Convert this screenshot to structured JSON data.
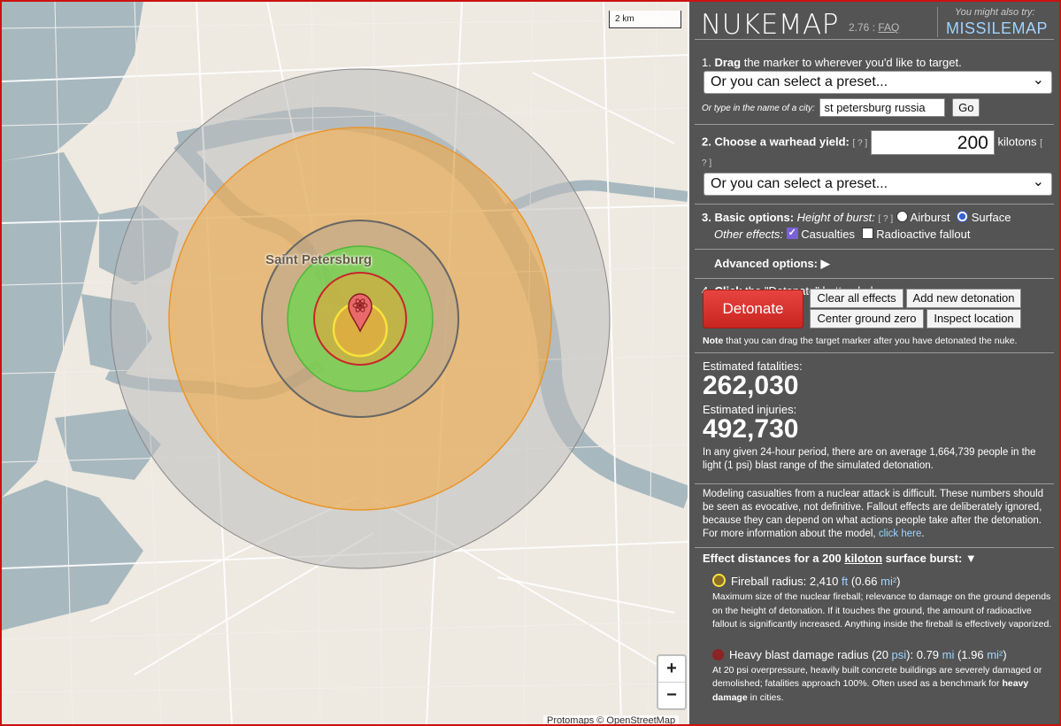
{
  "map": {
    "scale_label": "2 km",
    "city_label": "Saint Petersburg",
    "zoom_in": "+",
    "zoom_out": "−",
    "attribution": "Protomaps © OpenStreetMap"
  },
  "header": {
    "logo": "NUKEMAP",
    "version": "2.76 :",
    "faq": "FAQ",
    "also_try": "You might also try:",
    "missilemap": "MISSILEMAP"
  },
  "step1": {
    "prefix": "1. ",
    "bold": "Drag",
    "text": " the marker to wherever you'd like to target.",
    "preset_placeholder": "Or you can select a preset...",
    "city_prompt": "Or type in the name of a city:",
    "city_value": "st petersburg russia",
    "go_label": "Go"
  },
  "step2": {
    "label": "2. Choose a warhead yield:",
    "help": "[ ? ]",
    "yield_value": "200",
    "unit": "kilotons",
    "unit_help": "[ ? ]",
    "preset_placeholder": "Or you can select a preset..."
  },
  "step3": {
    "label": "3. Basic options:",
    "height_label": "Height of burst:",
    "height_help": "[ ? ]",
    "airburst": "Airburst",
    "surface": "Surface",
    "other_label": "Other effects:",
    "casualties": "Casualties",
    "fallout": "Radioactive fallout",
    "advanced": "Advanced options: ▶"
  },
  "step4": {
    "prefix": "4. ",
    "bold": "Click",
    "text": " the \"Detonate\" button below.",
    "detonate": "Detonate",
    "clear": "Clear all effects",
    "add": "Add new detonation",
    "center": "Center ground zero",
    "inspect": "Inspect location",
    "note_bold": "Note",
    "note_text": " that you can drag the target marker after you have detonated the nuke."
  },
  "results": {
    "fatalities_label": "Estimated fatalities:",
    "fatalities": "262,030",
    "injuries_label": "Estimated injuries:",
    "injuries": "492,730",
    "period_text": "In any given 24-hour period, there are on average 1,664,739 people in the light (1 psi) blast range of the simulated detonation.",
    "modeling_text": "Modeling casualties from a nuclear attack is difficult. These numbers should be seen as evocative, not definitive. Fallout effects are deliberately ignored, because they can depend on what actions people take after the detonation. For more information about the model,",
    "click_here": "click here",
    "period_end": "."
  },
  "effects": {
    "heading_a": "Effect distances for a 200 ",
    "heading_kt": "kiloton",
    "heading_b": " surface burst: ▼",
    "fireball_title": "Fireball radius: 2,410 ",
    "fireball_ft": "ft",
    "fireball_mid": " (0.66 ",
    "fireball_mi": "mi²",
    "fireball_end": ")",
    "fireball_desc": "Maximum size of the nuclear fireball; relevance to damage on the ground depends on the height of detonation. If it touches the ground, the amount of radioactive fallout is significantly increased. Anything inside the fireball is effectively vaporized.",
    "heavy_title": "Heavy blast damage radius (20 ",
    "heavy_psi": "psi",
    "heavy_mid": "): 0.79 ",
    "heavy_mi": "mi",
    "heavy_mid2": " (1.96 ",
    "heavy_mi2": "mi²",
    "heavy_end": ")",
    "heavy_desc_a": "At 20 psi overpressure, heavily built concrete buildings are severely damaged or demolished; fatalities approach 100%. Often used as a benchmark for ",
    "heavy_desc_bold": "heavy damage",
    "heavy_desc_b": " in cities."
  },
  "colors": {
    "panel_bg": "#545454",
    "fireball": "#f7e33a",
    "heavy_blast": "#c8262b",
    "radiation": "#44c33a",
    "moderate_blast": "#777777",
    "thermal": "#f4a734",
    "light_blast": "#bbbbbb",
    "detonate": "#d6302b",
    "link": "#9fd3ff"
  }
}
